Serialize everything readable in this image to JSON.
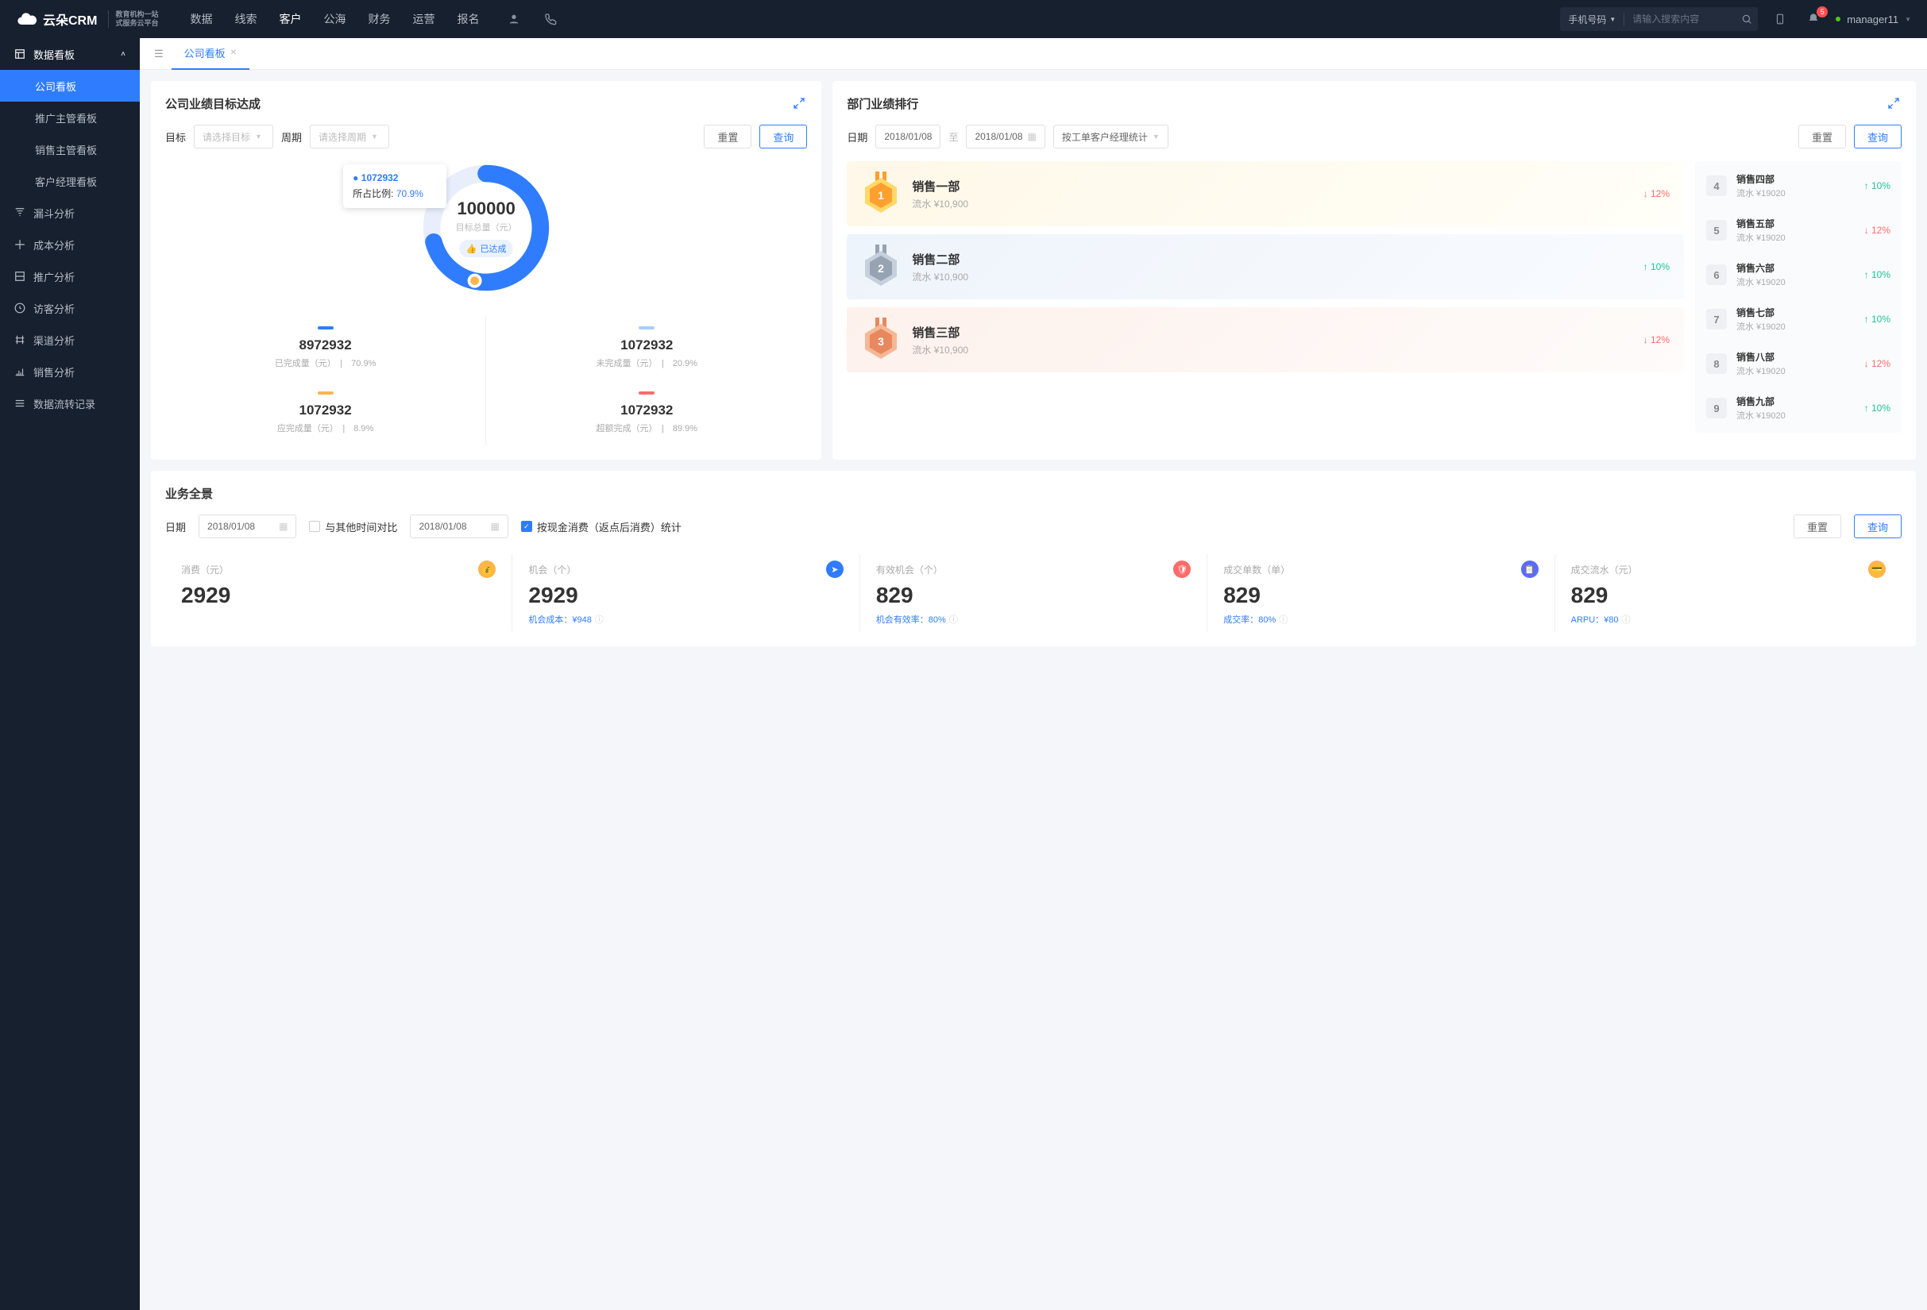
{
  "brand": {
    "name": "云朵CRM",
    "sub1": "教育机构一站",
    "sub2": "式服务云平台"
  },
  "topnav": [
    "数据",
    "线索",
    "客户",
    "公海",
    "财务",
    "运营",
    "报名"
  ],
  "topnav_active": 2,
  "search": {
    "type": "手机号码",
    "placeholder": "请输入搜索内容"
  },
  "notif_count": "5",
  "user": "manager11",
  "sidebar": {
    "group": "数据看板",
    "subs": [
      "公司看板",
      "推广主管看板",
      "销售主管看板",
      "客户经理看板"
    ],
    "items": [
      "漏斗分析",
      "成本分析",
      "推广分析",
      "访客分析",
      "渠道分析",
      "销售分析",
      "数据流转记录"
    ]
  },
  "tab": "公司看板",
  "goal": {
    "title": "公司业绩目标达成",
    "target_label": "目标",
    "target_ph": "请选择目标",
    "period_label": "周期",
    "period_ph": "请选择周期",
    "reset": "重置",
    "query": "查询",
    "center_num": "100000",
    "center_sub": "目标总量（元）",
    "badge": "已达成",
    "tip_val": "1072932",
    "tip_label": "所占比例:",
    "tip_pct": "70.9%",
    "stats": [
      {
        "color": "#2f7cff",
        "n": "8972932",
        "l": "已完成量（元）",
        "p": "70.9%"
      },
      {
        "color": "#a9ccff",
        "n": "1072932",
        "l": "未完成量（元）",
        "p": "20.9%"
      },
      {
        "color": "#ffb648",
        "n": "1072932",
        "l": "应完成量（元）",
        "p": "8.9%"
      },
      {
        "color": "#ff6b6b",
        "n": "1072932",
        "l": "超额完成（元）",
        "p": "89.9%"
      }
    ]
  },
  "rank": {
    "title": "部门业绩排行",
    "date_label": "日期",
    "d1": "2018/01/08",
    "to": "至",
    "d2": "2018/01/08",
    "mode": "按工单客户经理统计",
    "reset": "重置",
    "query": "查询",
    "top": [
      {
        "name": "销售一部",
        "sub": "流水 ¥10,900",
        "pct": "12%",
        "dir": "down"
      },
      {
        "name": "销售二部",
        "sub": "流水 ¥10,900",
        "pct": "10%",
        "dir": "up"
      },
      {
        "name": "销售三部",
        "sub": "流水 ¥10,900",
        "pct": "12%",
        "dir": "down"
      }
    ],
    "list": [
      {
        "n": "4",
        "name": "销售四部",
        "sub": "流水 ¥19020",
        "pct": "10%",
        "dir": "up"
      },
      {
        "n": "5",
        "name": "销售五部",
        "sub": "流水 ¥19020",
        "pct": "12%",
        "dir": "down"
      },
      {
        "n": "6",
        "name": "销售六部",
        "sub": "流水 ¥19020",
        "pct": "10%",
        "dir": "up"
      },
      {
        "n": "7",
        "name": "销售七部",
        "sub": "流水 ¥19020",
        "pct": "10%",
        "dir": "up"
      },
      {
        "n": "8",
        "name": "销售八部",
        "sub": "流水 ¥19020",
        "pct": "12%",
        "dir": "down"
      },
      {
        "n": "9",
        "name": "销售九部",
        "sub": "流水 ¥19020",
        "pct": "10%",
        "dir": "up"
      }
    ]
  },
  "ov": {
    "title": "业务全景",
    "date_label": "日期",
    "d1": "2018/01/08",
    "cmp": "与其他时间对比",
    "d2": "2018/01/08",
    "chk_label": "按现金消费（返点后消费）统计",
    "reset": "重置",
    "query": "查询",
    "kpis": [
      {
        "label": "消费（元）",
        "n": "2929",
        "foot": "",
        "ic": "#ffb648"
      },
      {
        "label": "机会（个）",
        "n": "2929",
        "foot": "机会成本：¥948",
        "ic": "#2f7cff"
      },
      {
        "label": "有效机会（个）",
        "n": "829",
        "foot": "机会有效率：80%",
        "ic": "#ff6b6b"
      },
      {
        "label": "成交单数（单）",
        "n": "829",
        "foot": "成交率：80%",
        "ic": "#5b6bff"
      },
      {
        "label": "成交流水（元）",
        "n": "829",
        "foot": "ARPU：¥80",
        "ic": "#ffb648"
      }
    ]
  },
  "chart_data": {
    "type": "pie",
    "title": "公司业绩目标达成",
    "total": 100000,
    "series": [
      {
        "name": "已完成量",
        "value": 8972932,
        "pct": 70.9,
        "color": "#2f7cff"
      },
      {
        "name": "未完成量",
        "value": 1072932,
        "pct": 20.9,
        "color": "#a9ccff"
      },
      {
        "name": "应完成量",
        "value": 1072932,
        "pct": 8.9,
        "color": "#ffb648"
      },
      {
        "name": "超额完成",
        "value": 1072932,
        "pct": 89.9,
        "color": "#ff6b6b"
      }
    ]
  }
}
